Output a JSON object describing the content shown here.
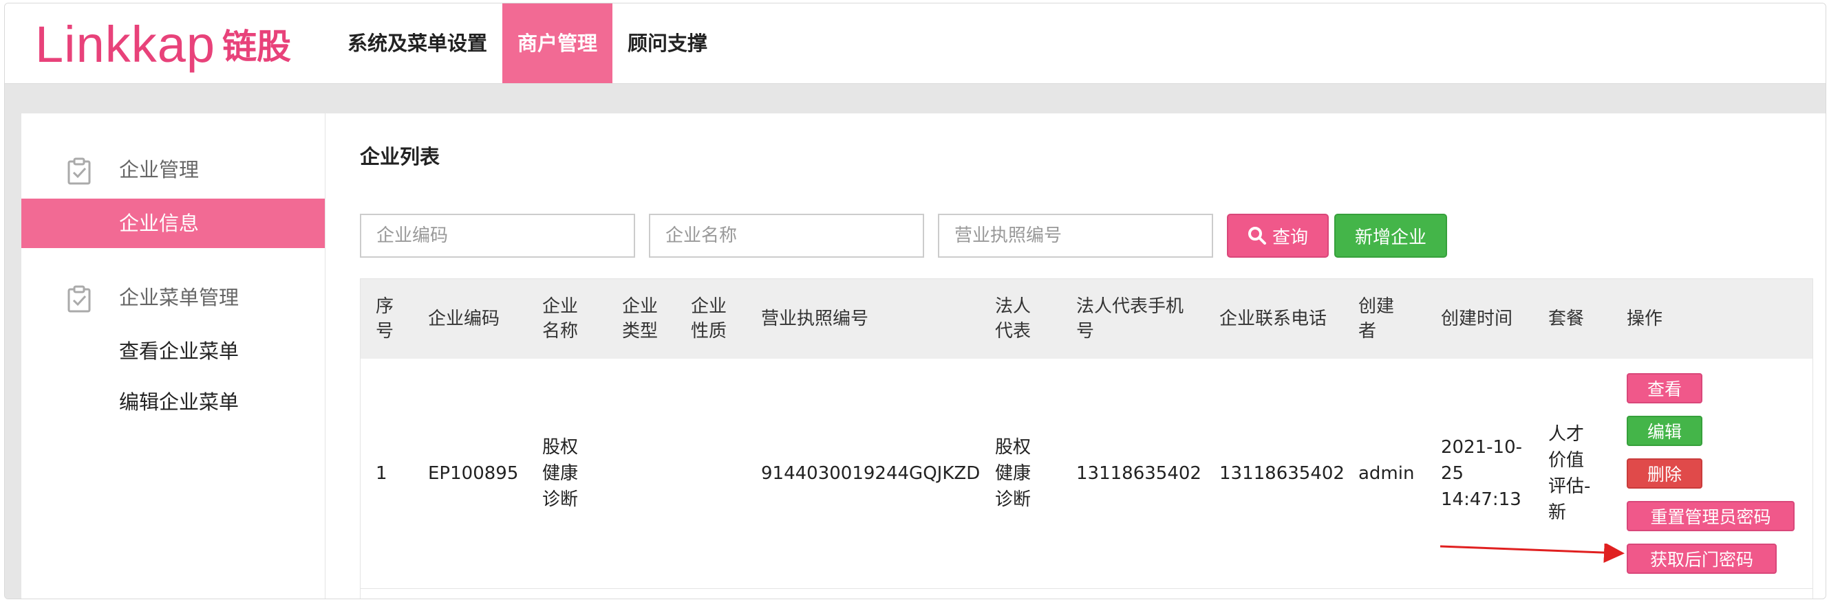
{
  "brand": {
    "logo_latin": "Linkkap",
    "logo_cn": "链股",
    "color": "#e8427a"
  },
  "nav": {
    "items": [
      {
        "label": "系统及菜单设置",
        "active": false
      },
      {
        "label": "商户管理",
        "active": true
      },
      {
        "label": "顾问支撑",
        "active": false
      }
    ]
  },
  "sidebar": {
    "groups": [
      {
        "label": "企业管理",
        "icon": "clipboard-check-icon",
        "items": [
          {
            "label": "企业信息",
            "active": true
          }
        ]
      },
      {
        "label": "企业菜单管理",
        "icon": "clipboard-check-icon",
        "items": [
          {
            "label": "查看企业菜单",
            "active": false
          },
          {
            "label": "编辑企业菜单",
            "active": false
          }
        ]
      }
    ]
  },
  "main": {
    "title": "企业列表",
    "filters": {
      "code_placeholder": "企业编码",
      "name_placeholder": "企业名称",
      "license_placeholder": "营业执照编号"
    },
    "search_button": "查询",
    "add_button": "新增企业",
    "table": {
      "headers": {
        "index": "序\n号",
        "code": "企业编码",
        "name": "企业\n名称",
        "type": "企业\n类型",
        "nature": "企业\n性质",
        "license": "营业执照编号",
        "legal": "法人\n代表",
        "legal_phone": "法人代表手机\n号",
        "contact_phone": "企业联系电话",
        "creator": "创建\n者",
        "created_at": "创建时间",
        "package": "套餐",
        "actions": "操作"
      },
      "rows": [
        {
          "index": "1",
          "code": "EP100895",
          "name": "股权\n健康\n诊断",
          "type": "",
          "nature": "",
          "license": "9144030019244GQJKZD",
          "legal": "股权\n健康\n诊断",
          "legal_phone": "13118635402",
          "contact_phone": "13118635402",
          "creator": "admin",
          "created_at": "2021-10-\n25\n14:47:13",
          "package": "人才\n价值\n评估-\n新",
          "actions": {
            "view": "查看",
            "edit": "编辑",
            "delete": "删除",
            "reset_password": "重置管理员密码",
            "backdoor_password": "获取后门密码"
          }
        }
      ]
    }
  },
  "colors": {
    "accent": "#f26a94",
    "green": "#44b549",
    "red": "#e04a4a",
    "annotation": "#e02020"
  }
}
